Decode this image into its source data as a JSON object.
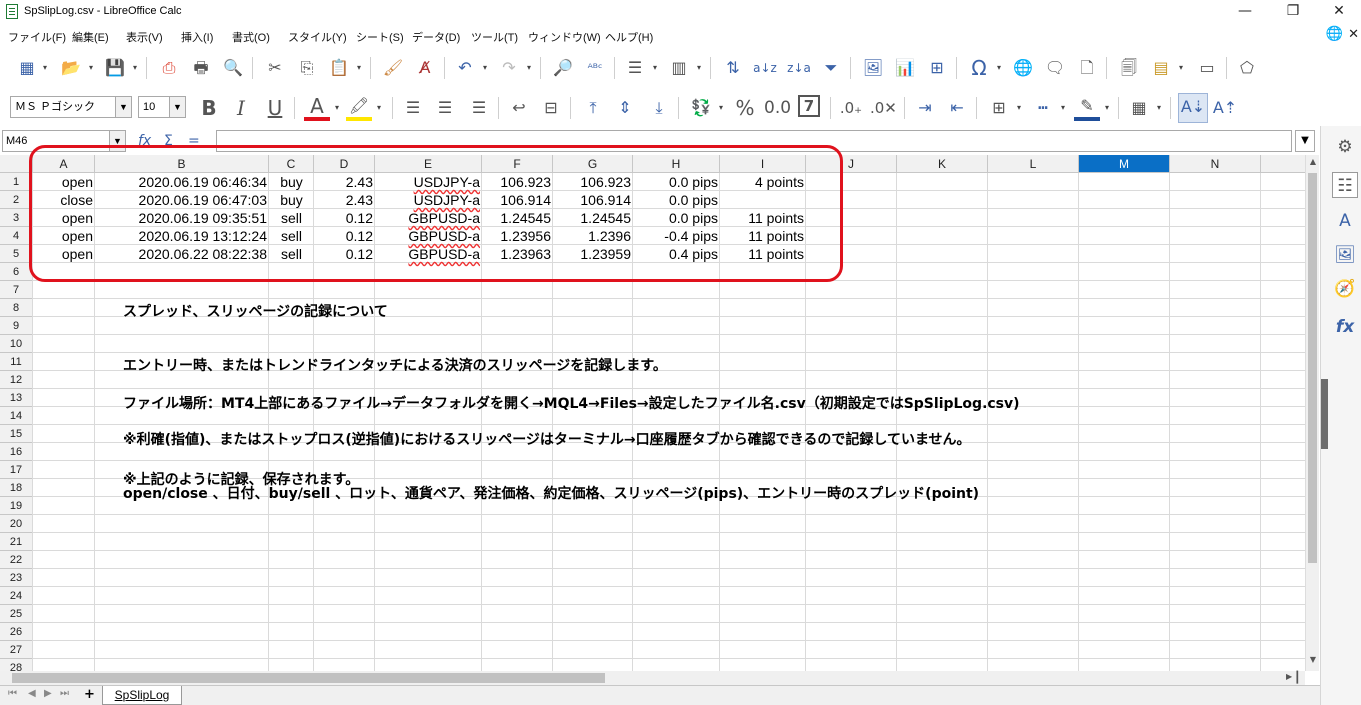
{
  "window": {
    "title": "SpSlipLog.csv - LibreOffice Calc",
    "minimize": "—",
    "restore": "❐",
    "close": "✕"
  },
  "menu": [
    {
      "label": "ファイル(F)"
    },
    {
      "label": "編集(E)"
    },
    {
      "label": "表示(V)"
    },
    {
      "label": "挿入(I)"
    },
    {
      "label": "書式(O)"
    },
    {
      "label": "スタイル(Y)"
    },
    {
      "label": "シート(S)"
    },
    {
      "label": "データ(D)"
    },
    {
      "label": "ツール(T)"
    },
    {
      "label": "ウィンドウ(W)"
    },
    {
      "label": "ヘルプ(H)"
    }
  ],
  "format": {
    "font_name": "ＭＳ Ｐゴシック",
    "font_size": "10"
  },
  "formula": {
    "cell_ref": "M46",
    "value": ""
  },
  "columns": [
    "A",
    "B",
    "C",
    "D",
    "E",
    "F",
    "G",
    "H",
    "I",
    "J",
    "K",
    "L",
    "M",
    "N"
  ],
  "selected_column": "M",
  "rows": [
    {
      "num": "1",
      "a": "open",
      "b": "2020.06.19 06:46:34",
      "c": "buy",
      "d": "2.43",
      "e": "USDJPY-a",
      "f": "106.923",
      "g": "106.923",
      "h": "0.0 pips",
      "i": "4 points"
    },
    {
      "num": "2",
      "a": "close",
      "b": "2020.06.19 06:47:03",
      "c": "buy",
      "d": "2.43",
      "e": "USDJPY-a",
      "f": "106.914",
      "g": "106.914",
      "h": "0.0 pips",
      "i": ""
    },
    {
      "num": "3",
      "a": "open",
      "b": "2020.06.19 09:35:51",
      "c": "sell",
      "d": "0.12",
      "e": "GBPUSD-a",
      "f": "1.24545",
      "g": "1.24545",
      "h": "0.0 pips",
      "i": "11 points"
    },
    {
      "num": "4",
      "a": "open",
      "b": "2020.06.19 13:12:24",
      "c": "sell",
      "d": "0.12",
      "e": "GBPUSD-a",
      "f": "1.23956",
      "g": "1.2396",
      "h": "-0.4 pips",
      "i": "11 points"
    },
    {
      "num": "5",
      "a": "open",
      "b": "2020.06.22 08:22:38",
      "c": "sell",
      "d": "0.12",
      "e": "GBPUSD-a",
      "f": "1.23963",
      "g": "1.23959",
      "h": "0.4 pips",
      "i": "11 points"
    }
  ],
  "empty_row_numbers": [
    "6",
    "7",
    "8",
    "9",
    "10",
    "11",
    "12",
    "13",
    "14",
    "15",
    "16",
    "17",
    "18",
    "19",
    "20",
    "21",
    "22",
    "23",
    "24",
    "25",
    "26",
    "27",
    "28"
  ],
  "notes": [
    {
      "row": "8",
      "text": "スプレッド、スリッページの記録について"
    },
    {
      "row": "11",
      "text": "エントリー時、またはトレンドラインタッチによる決済のスリッページを記録します。"
    },
    {
      "row": "13",
      "text": "ファイル場所：MT4上部にあるファイル→データフォルダを開く→MQL4→Files→設定したファイル名.csv（初期設定ではSpSlipLog.csv)"
    },
    {
      "row": "15",
      "text": "※利確(指値)、またはストップロス(逆指値)におけるスリッページはターミナル→口座履歴タブから確認できるので記録していません。"
    },
    {
      "row": "17",
      "text": "※上記のように記録、保存されます。"
    },
    {
      "row": "18",
      "text": "open/close 、日付、buy/sell 、ロット、通貨ペア、発注価格、約定価格、スリッページ(pips)、エントリー時のスプレッド(point)"
    }
  ],
  "sheet_tab": "SpSlipLog",
  "colors": {
    "highlight": "#e0121d",
    "selected_header": "#0a6fc6"
  }
}
